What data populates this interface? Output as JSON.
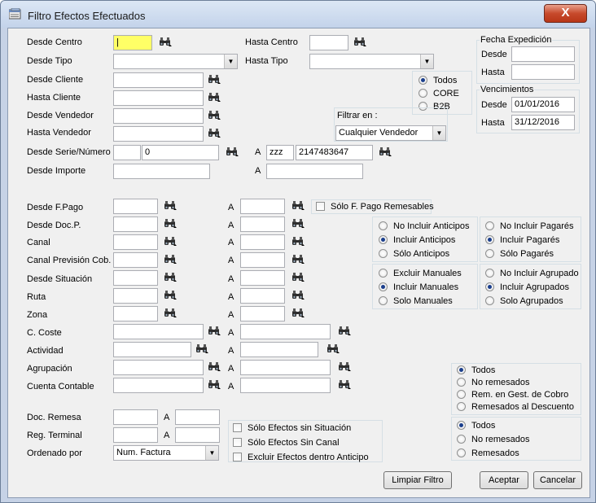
{
  "window": {
    "title": "Filtro Efectos Efectuados",
    "close": "X"
  },
  "labels": {
    "desde_centro": "Desde Centro",
    "hasta_centro": "Hasta Centro",
    "desde_tipo": "Desde Tipo",
    "hasta_tipo": "Hasta Tipo",
    "desde_cliente": "Desde Cliente",
    "hasta_cliente": "Hasta Cliente",
    "desde_vendedor": "Desde Vendedor",
    "hasta_vendedor": "Hasta Vendedor",
    "desde_serie": "Desde Serie/Número",
    "desde_importe": "Desde Importe",
    "a": "A",
    "desde_fpago": "Desde F.Pago",
    "desde_docp": "Desde Doc.P.",
    "canal": "Canal",
    "canal_prevision": "Canal Previsión Cob.",
    "desde_situacion": "Desde Situación",
    "ruta": "Ruta",
    "zona": "Zona",
    "c_coste": "C. Coste",
    "actividad": "Actividad",
    "agrupacion": "Agrupación",
    "cuenta_contable": "Cuenta Contable",
    "doc_remesa": "Doc. Remesa",
    "reg_terminal": "Reg. Terminal",
    "ordenado_por": "Ordenado por",
    "filtrar_en": "Filtrar en :",
    "fecha_expedicion": "Fecha Expedición",
    "desde": "Desde",
    "hasta": "Hasta",
    "vencimientos": "Vencimientos"
  },
  "values": {
    "desde_centro": "|",
    "serie_numero": "0",
    "serie_hasta": "zzz",
    "numero_hasta": "2147483647",
    "venc_desde": "01/01/2016",
    "venc_hasta": "31/12/2016",
    "filtrar_en": "Cualquier Vendedor",
    "ordenado_por": "Num. Factura"
  },
  "mandate": {
    "todos": "Todos",
    "core": "CORE",
    "b2b": "B2B"
  },
  "checks": {
    "solo_fpago": "Sólo F. Pago Remesables",
    "sin_situacion": "Sólo Efectos sin Situación",
    "sin_canal": "Sólo Efectos Sin Canal",
    "excluir_anticipo": "Excluir Efectos dentro Anticipo"
  },
  "anticipos": [
    "No Incluir Anticipos",
    "Incluir Anticipos",
    "Sólo Anticipos"
  ],
  "pagares": [
    "No Incluir Pagarés",
    "Incluir Pagarés",
    "Sólo Pagarés"
  ],
  "manuales": [
    "Excluir Manuales",
    "Incluir Manuales",
    "Solo Manuales"
  ],
  "agrupados": [
    "No Incluir Agrupado",
    "Incluir Agrupados",
    "Solo Agrupados"
  ],
  "remesas": [
    "Todos",
    "No remesados",
    "Rem. en Gest. de Cobro",
    "Remesados al Descuento"
  ],
  "remesas2": [
    "Todos",
    "No remesados",
    "Remesados"
  ],
  "buttons": {
    "limpiar": "Limpiar Filtro",
    "aceptar": "Aceptar",
    "cancelar": "Cancelar"
  },
  "colors": {
    "highlight": "#ffff66",
    "window": "#c6d2e6",
    "close": "#c74a2c"
  }
}
